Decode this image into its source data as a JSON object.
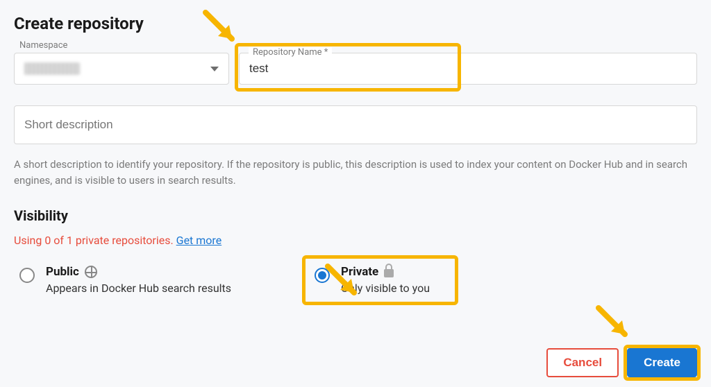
{
  "page_title": "Create repository",
  "namespace": {
    "label": "Namespace"
  },
  "repo_name": {
    "label": "Repository Name *",
    "value": "test"
  },
  "short_description": {
    "placeholder": "Short description"
  },
  "help_text": "A short description to identify your repository. If the repository is public, this description is used to index your content on Docker Hub and in search engines, and is visible to users in search results.",
  "visibility": {
    "title": "Visibility",
    "usage_prefix": "Using 0 of 1 private repositories. ",
    "get_more": "Get more",
    "public": {
      "title": "Public",
      "sub": "Appears in Docker Hub search results"
    },
    "private": {
      "title": "Private",
      "sub": "Only visible to you"
    }
  },
  "buttons": {
    "cancel": "Cancel",
    "create": "Create"
  }
}
